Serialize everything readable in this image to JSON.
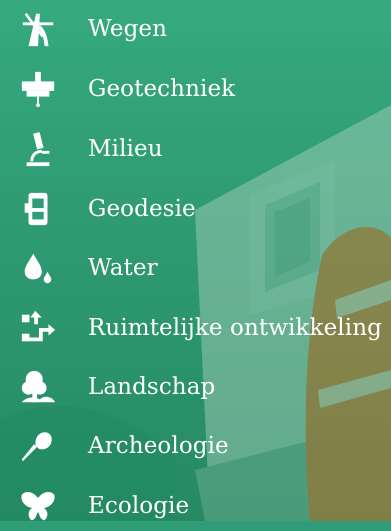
{
  "menu": {
    "items": [
      {
        "label": "Wegen",
        "icon": "road-icon"
      },
      {
        "label": "Geotechniek",
        "icon": "drill-rig-icon"
      },
      {
        "label": "Milieu",
        "icon": "microscope-icon"
      },
      {
        "label": "Geodesie",
        "icon": "total-station-icon"
      },
      {
        "label": "Water",
        "icon": "water-drops-icon"
      },
      {
        "label": "Ruimtelijke ontwikkeling",
        "icon": "spatial-arrows-icon"
      },
      {
        "label": "Landschap",
        "icon": "tree-icon"
      },
      {
        "label": "Archeologie",
        "icon": "trowel-icon"
      },
      {
        "label": "Ecologie",
        "icon": "butterfly-icon"
      }
    ]
  },
  "colors": {
    "background": "#2f9d78",
    "text": "#ffffff",
    "worker_vest": "#ff6f1f"
  }
}
